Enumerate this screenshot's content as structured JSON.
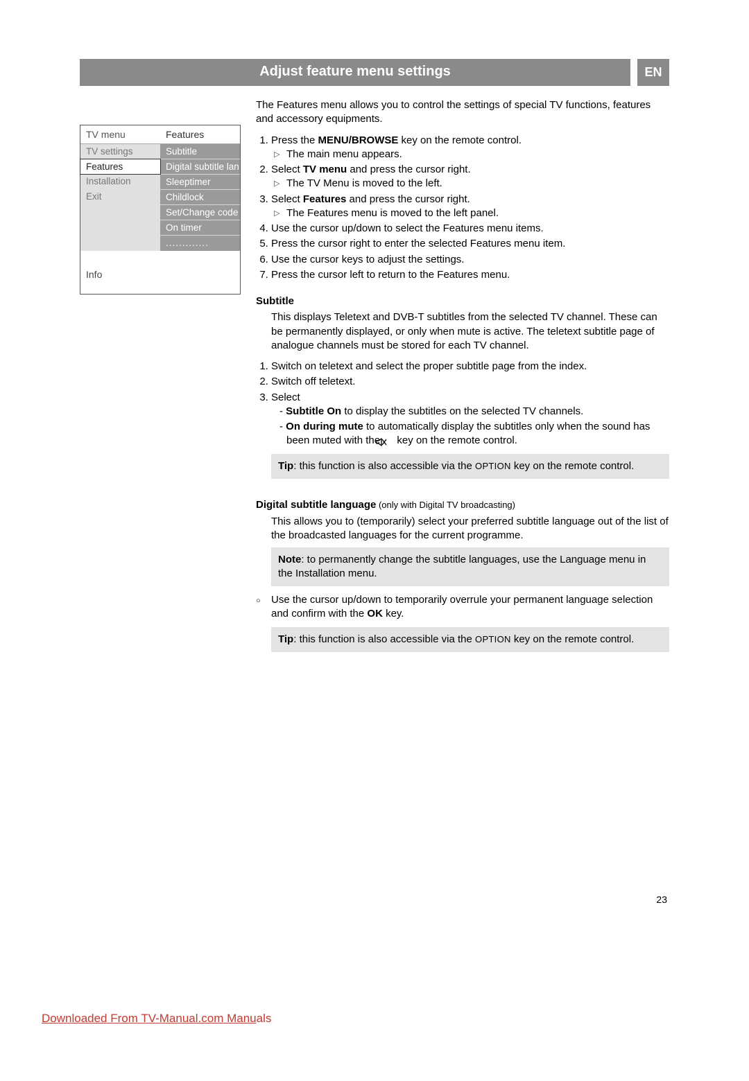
{
  "header": {
    "title": "Adjust feature menu settings",
    "lang": "EN"
  },
  "menu": {
    "left_header": "TV menu",
    "right_header": "Features",
    "left_items": [
      "TV settings",
      "Features",
      "Installation",
      "Exit"
    ],
    "right_items": [
      "Subtitle",
      "Digital subtitle lan..",
      "Sleeptimer",
      "Childlock",
      "Set/Change code",
      "On timer"
    ],
    "info": "Info"
  },
  "intro": "The Features menu allows you to control the settings of special TV functions, features and accessory equipments.",
  "steps": {
    "s1a": "Press the ",
    "s1b": "MENU/BROWSE",
    "s1c": " key on the remote control.",
    "s1sub": "The main menu appears.",
    "s2a": "Select ",
    "s2b": "TV menu",
    "s2c": " and press the cursor right.",
    "s2sub": "The TV Menu is moved to the left.",
    "s3a": "Select ",
    "s3b": "Features",
    "s3c": " and press the cursor right.",
    "s3sub": "The Features menu is moved to the left panel.",
    "s4": "Use the cursor up/down to select the Features menu items.",
    "s5": "Press the cursor right to enter the selected Features menu item.",
    "s6": "Use the cursor keys to adjust the settings.",
    "s7": "Press the cursor left to return to the Features menu."
  },
  "subtitle": {
    "head": "Subtitle",
    "para": "This displays Teletext and DVB-T subtitles from the selected TV channel. These can be permanently displayed, or only when mute is active. The teletext subtitle page of analogue channels must be stored for each TV channel.",
    "st1": "Switch on teletext and select the proper subtitle page from the index.",
    "st2": "Switch off teletext.",
    "st3": "Select",
    "d1a": "Subtitle On",
    "d1b": " to display the subtitles on the selected TV channels.",
    "d2a": "On during mute",
    "d2b": " to automatically display the subtitles only when the sound has been muted with the ",
    "d2c": " key on the remote control.",
    "tip_label": "Tip",
    "tip_a": ": this function is also accessible via the ",
    "tip_b": "OPTION",
    "tip_c": " key on the remote control."
  },
  "digital": {
    "head": "Digital subtitle language",
    "head_note": " (only with Digital TV broadcasting)",
    "para": "This allows you to (temporarily) select your preferred subtitle language out of the list of the broadcasted languages for the current programme.",
    "note_label": "Note",
    "note": ": to permanently change the subtitle languages, use the Language menu in the Installation menu.",
    "circ_a": "Use the cursor up/down to temporarily overrule your permanent language selection and confirm with the ",
    "circ_b": "OK",
    "circ_c": " key.",
    "tip_label": "Tip",
    "tip_a": ": this function is also accessible via the ",
    "tip_b": "OPTION",
    "tip_c": " key on the remote control."
  },
  "pagenum": "23",
  "footer": {
    "a": "Downloaded From TV-Manual.com Manu",
    "b": "als"
  }
}
